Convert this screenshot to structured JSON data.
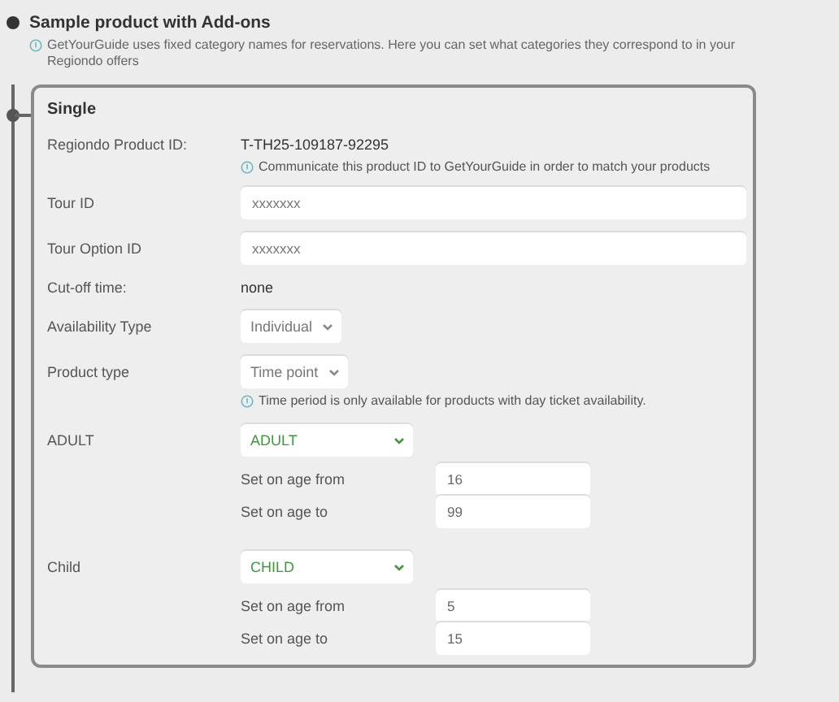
{
  "section": {
    "title": "Sample product with Add-ons",
    "hint": "GetYourGuide uses fixed category names for reservations. Here you can set what categories they correspond to in your Regiondo offers"
  },
  "card": {
    "title": "Single",
    "rows": [
      {
        "kind": "text",
        "label": "Regiondo Product ID:",
        "value": "T-TH25-109187-92295",
        "hint": "Communicate this product ID to GetYourGuide in order to match your products"
      },
      {
        "kind": "input",
        "label": "Tour ID",
        "placeholder": "xxxxxxx"
      },
      {
        "kind": "input",
        "label": "Tour Option ID",
        "placeholder": "xxxxxxx"
      },
      {
        "kind": "text",
        "label": "Cut-off time:",
        "value": "none"
      },
      {
        "kind": "select",
        "label": "Availability Type",
        "value": "Individual"
      },
      {
        "kind": "select",
        "label": "Product type",
        "value": "Time point",
        "hint": "Time period is only available for products with day ticket availability."
      },
      {
        "kind": "category",
        "label": "ADULT",
        "value": "ADULT",
        "from_label": "Set on age from",
        "from": "16",
        "to_label": "Set on age to",
        "to": "99"
      },
      {
        "kind": "category",
        "label": "Child",
        "value": "CHILD",
        "from_label": "Set on age from",
        "from": "5",
        "to_label": "Set on age to",
        "to": "15"
      }
    ]
  }
}
